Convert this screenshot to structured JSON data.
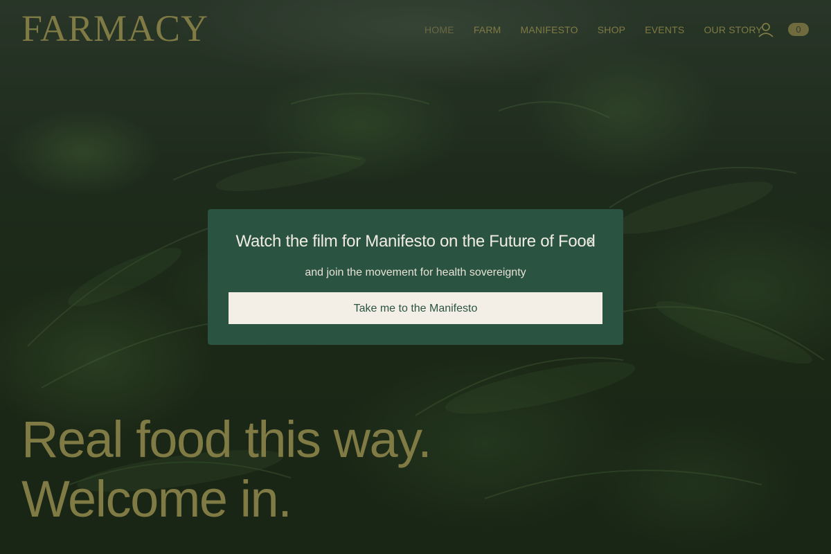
{
  "brand": {
    "logo_text": "FARMACY"
  },
  "nav": {
    "items": [
      {
        "label": "HOME",
        "active": true
      },
      {
        "label": "FARM",
        "active": false
      },
      {
        "label": "MANIFESTO",
        "active": false
      },
      {
        "label": "SHOP",
        "active": false
      },
      {
        "label": "EVENTS",
        "active": false
      },
      {
        "label": "OUR STORY",
        "active": false
      }
    ]
  },
  "header_icons": {
    "account": "user-icon",
    "cart_count": "0"
  },
  "modal": {
    "title": "Watch the film for Manifesto on the Future of Food",
    "close_glyph": "×",
    "subtitle": "and join the movement for health sovereignty",
    "cta_label": "Take me to the Manifesto"
  },
  "hero": {
    "line1": "Real food this way.",
    "line2": "Welcome in."
  },
  "colors": {
    "olive_text": "#807a45",
    "modal_bg": "#2a5341",
    "cta_bg": "#f4efe6"
  }
}
